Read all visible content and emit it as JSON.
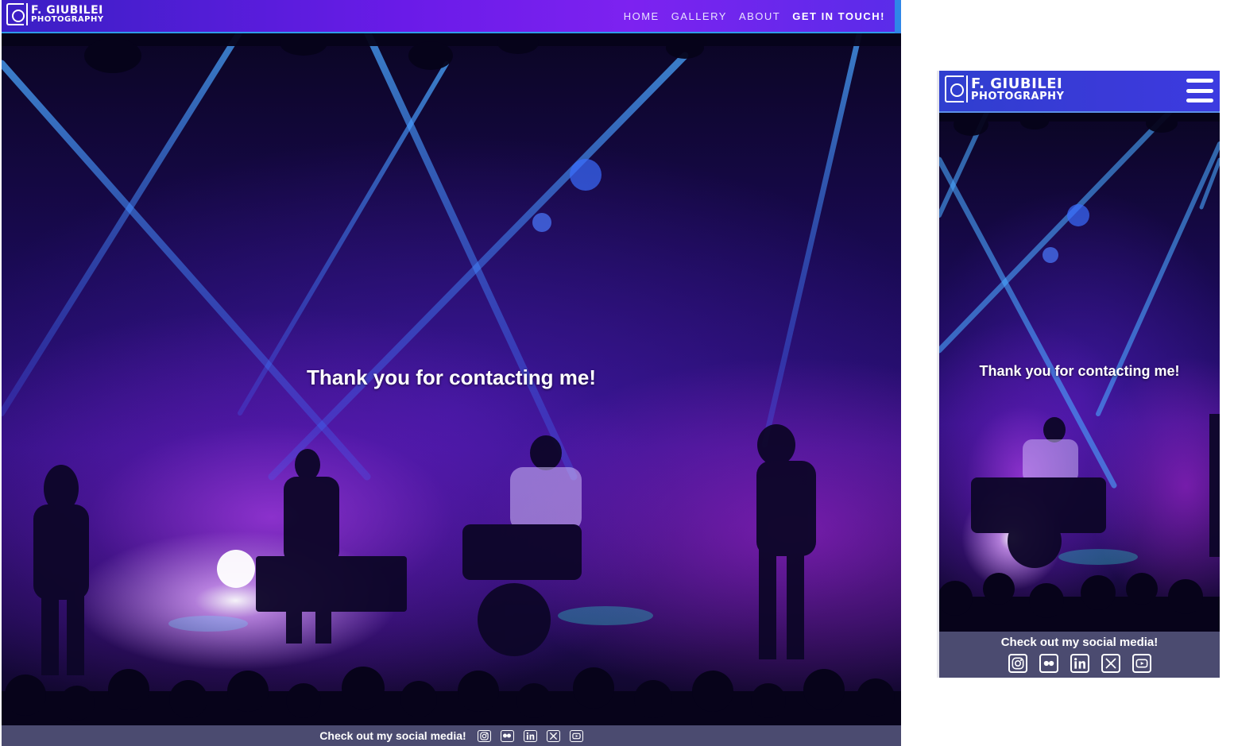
{
  "brand": {
    "line1": "F. GIUBILEI",
    "line2": "PHOTOGRAPHY"
  },
  "nav": {
    "items": [
      "HOME",
      "GALLERY",
      "ABOUT",
      "GET IN TOUCH!"
    ],
    "active": "GET IN TOUCH!"
  },
  "main": {
    "thanks": "Thank you for contacting me!"
  },
  "footer": {
    "text": "Check out my social media!",
    "icons": [
      "instagram-icon",
      "flickr-icon",
      "linkedin-icon",
      "x-icon",
      "youtube-icon"
    ]
  },
  "colors": {
    "nav_gradient_start": "#3a1fc4",
    "nav_gradient_end": "#7d22f0",
    "mobile_nav": "#3a3ad8",
    "footer_bg": "#4b4b70",
    "text": "#ffffff"
  }
}
